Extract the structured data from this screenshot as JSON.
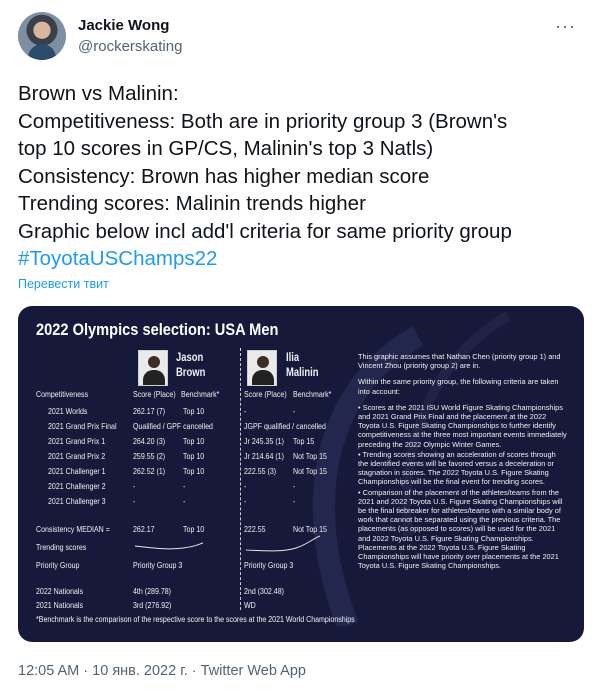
{
  "author": {
    "display_name": "Jackie Wong",
    "handle": "@rockerskating",
    "more_label": "···"
  },
  "tweet": {
    "lines": [
      "Brown vs Malinin:",
      "Competitiveness: Both are in priority group 3 (Brown's",
      "top 10 scores in GP/CS, Malinin's top 3 Natls)",
      "Consistency: Brown has higher median score",
      "Trending scores: Malinin trends higher",
      "Graphic below incl add'l criteria for same priority group"
    ],
    "hashtag": "#ToyotaUSChamps22",
    "translate_label": "Перевести твит"
  },
  "graphic": {
    "title": "2022 Olympics selection: USA Men",
    "skaters": [
      {
        "first": "Jason",
        "last": "Brown"
      },
      {
        "first": "Ilia",
        "last": "Malinin"
      }
    ],
    "col_headers": [
      "Score (Place)",
      "Benchmark*",
      "Score (Place)",
      "Benchmark*"
    ],
    "rows": [
      {
        "label": "Competitiveness",
        "cells": [
          "",
          "",
          "",
          ""
        ]
      },
      {
        "label": "2021 Worlds",
        "cells": [
          "262.17 (7)",
          "Top 10",
          "-",
          "-"
        ]
      },
      {
        "label": "2021 Grand Prix Final",
        "cells": [
          "Qualified / GPF cancelled",
          "",
          "JGPF qualified / cancelled",
          ""
        ]
      },
      {
        "label": "2021 Grand Prix 1",
        "cells": [
          "264.20 (3)",
          "Top 10",
          "Jr 245.35 (1)",
          "Top 15"
        ]
      },
      {
        "label": "2021 Grand Prix 2",
        "cells": [
          "259.55 (2)",
          "Top 10",
          "Jr 214.64 (1)",
          "Not Top 15"
        ]
      },
      {
        "label": "2021 Challenger 1",
        "cells": [
          "262.52 (1)",
          "Top 10",
          "222.55 (3)",
          "Not Top 15"
        ]
      },
      {
        "label": "2021 Challenger 2",
        "cells": [
          "-",
          "-",
          "-",
          "-"
        ]
      },
      {
        "label": "2021 Challenger 3",
        "cells": [
          "-",
          "-",
          "-",
          "-"
        ]
      }
    ],
    "consistency": {
      "label": "Consistency  MEDIAN =",
      "cells": [
        "262.17",
        "Top 10",
        "222.55",
        "Not Top 15"
      ]
    },
    "trending_label": "Trending scores",
    "priority": {
      "label": "Priority Group",
      "cells": [
        "Priority Group 3",
        "Priority Group 3"
      ]
    },
    "nationals": [
      {
        "label": "2022 Nationals",
        "cells": [
          "4th (289.78)",
          "2nd (302.48)"
        ]
      },
      {
        "label": "2021 Nationals",
        "cells": [
          "3rd (276.92)",
          "WD"
        ]
      }
    ],
    "notes": [
      "This graphic assumes that Nathan Chen (priority group 1) and Vincent Zhou (priority group 2) are in.",
      "Within the same priority group, the following criteria are taken into account:",
      "• Scores at the 2021 ISU World Figure Skating Championships and 2021 Grand Prix Final and the placement at the 2022 Toyota U.S. Figure Skating Championships to further identify competitiveness at the three most important events immediately preceding the 2022 Olympic Winter Games.",
      "• Trending scores showing an acceleration of scores through the identified events will be favored versus a deceleration or stagnation in scores. The 2022 Toyota U.S. Figure Skating Championships will be the final event for trending scores.",
      "• Comparison of the placement of the athletes/teams from the 2021 and 2022 Toyota U.S. Figure Skating Championships will be the final tiebreaker for athletes/teams with a similar body of work that cannot be separated using the previous criteria. The placements (as opposed to scores) will be used for the 2021 and 2022 Toyota U.S. Figure Skating Championships. Placements at the 2022 Toyota U.S. Figure Skating Championships will have priority over placements at the 2021 Toyota U.S. Figure Skating Championships."
    ],
    "footnote": "*Benchmark is the comparison of the respective score to the scores at the 2021 World Championships"
  },
  "meta": {
    "time": "12:05 AM",
    "date": "10 янв. 2022 г.",
    "source": "Twitter Web App",
    "sep": " · "
  }
}
